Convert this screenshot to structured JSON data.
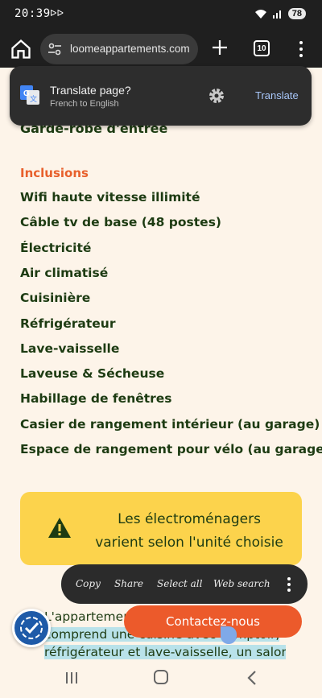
{
  "status": {
    "time": "20:39",
    "carrier_icon": "notification-glyph",
    "battery": "78"
  },
  "browser": {
    "url": "loomeappartements.com",
    "tab_count": "10"
  },
  "translate": {
    "title": "Translate page?",
    "subtitle": "French to English",
    "action": "Translate"
  },
  "page": {
    "cut_item": "Garde-robe d'entrée",
    "inclusions_heading": "Inclusions",
    "inclusions": [
      "Wifi haute vitesse illimité",
      "Câble tv de base (48 postes)",
      "Électricité",
      "Air climatisé",
      "Cuisinière",
      "Réfrigérateur",
      "Lave-vaisselle",
      "Laveuse & Sécheuse",
      "Habillage de fenêtres",
      "Casier de rangement intérieur (au garage)",
      "Espace de rangement pour vélo (au garage)"
    ],
    "notice_line1": "Les électroménagers",
    "notice_line2": "varient selon l'unité choisie",
    "para_line1": "L'appartement",
    "para_line2": "comprend une cuisine avec comptoir,",
    "para_line3": "réfrigérateur et lave-vaisselle, un salon"
  },
  "selection_menu": {
    "copy": "Copy",
    "share": "Share",
    "select_all": "Select all",
    "web_search": "Web search"
  },
  "contact_button": "Contactez-nous"
}
